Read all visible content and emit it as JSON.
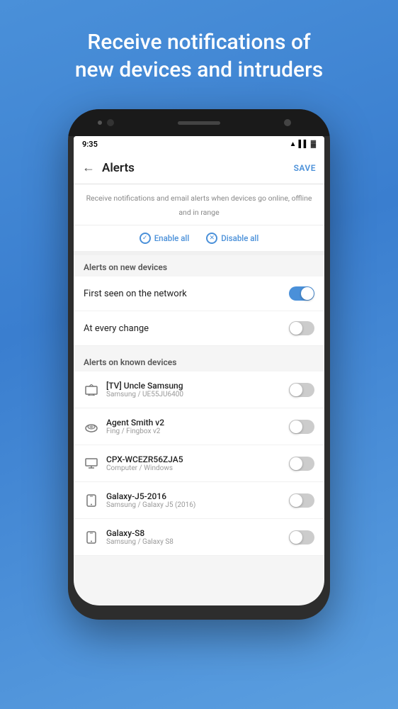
{
  "headline": {
    "line1": "Receive notifications of",
    "line2": "new devices and intruders"
  },
  "statusBar": {
    "time": "9:35"
  },
  "appBar": {
    "title": "Alerts",
    "save": "SAVE"
  },
  "subtitle": "Receive notifications and email alerts when devices go online, offline and in range",
  "actions": {
    "enableAll": "Enable all",
    "disableAll": "Disable all"
  },
  "sections": [
    {
      "header": "Alerts on new devices",
      "items": [
        {
          "title": "First seen on the network",
          "subtitle": "",
          "icon": "none",
          "state": "on"
        },
        {
          "title": "At every change",
          "subtitle": "",
          "icon": "none",
          "state": "off"
        }
      ]
    },
    {
      "header": "Alerts on known devices",
      "items": [
        {
          "title": "[TV] Uncle Samsung",
          "subtitle": "Samsung / UE55JU6400",
          "icon": "tv",
          "state": "off"
        },
        {
          "title": "Agent Smith v2",
          "subtitle": "Fing / Fingbox v2",
          "icon": "fingbox",
          "state": "off"
        },
        {
          "title": "CPX-WCEZR56ZJA5",
          "subtitle": "Computer / Windows",
          "icon": "computer",
          "state": "off"
        },
        {
          "title": "Galaxy-J5-2016",
          "subtitle": "Samsung / Galaxy J5 (2016)",
          "icon": "phone",
          "state": "off"
        },
        {
          "title": "Galaxy-S8",
          "subtitle": "Samsung / Galaxy S8",
          "icon": "phone",
          "state": "off"
        }
      ]
    }
  ]
}
